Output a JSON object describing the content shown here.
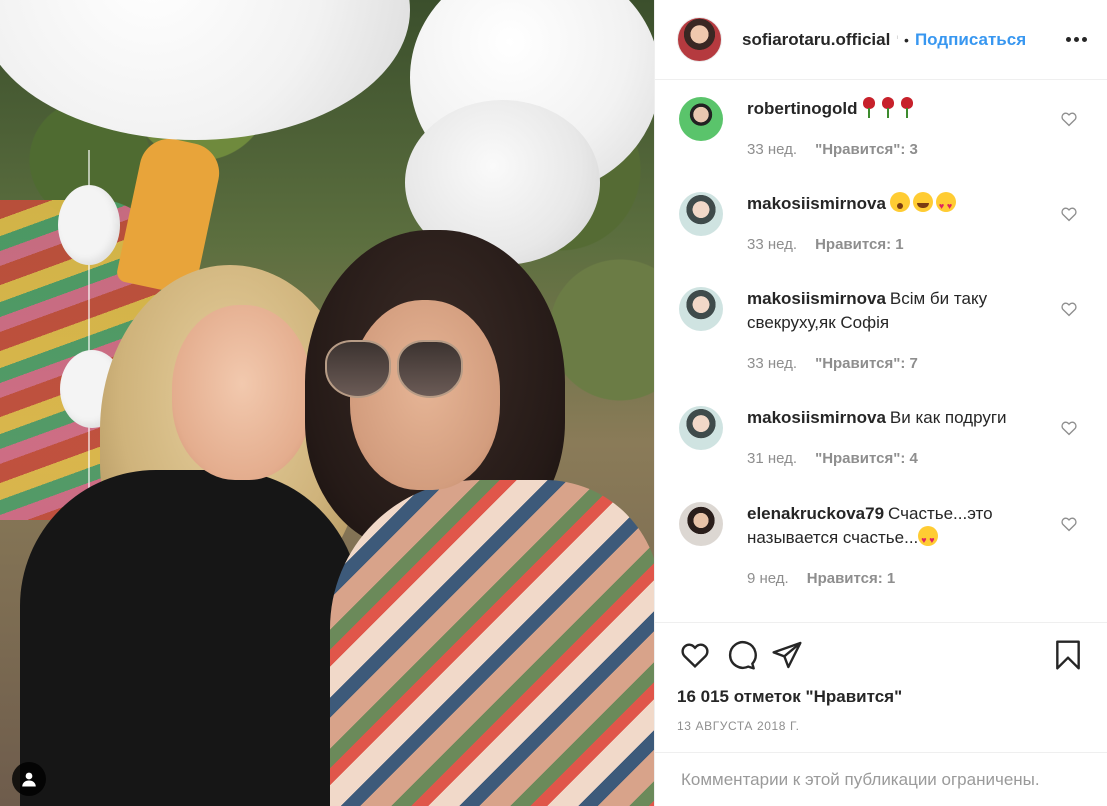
{
  "header": {
    "username": "sofiarotaru.official",
    "verified_mark": "ᑊ",
    "separator": "•",
    "follow_label": "Подписаться"
  },
  "comments": [
    {
      "username": "robertinogold",
      "text": "",
      "emojis": [
        "rose",
        "rose",
        "rose"
      ],
      "text_after": "",
      "time": "33 нед.",
      "likes": "\"Нравится\": 3",
      "avatar": "robertino"
    },
    {
      "username": "makosiismirnova",
      "text": "",
      "emojis": [
        "wow",
        "laugh",
        "hearts"
      ],
      "text_after": "",
      "time": "33 нед.",
      "likes": "Нравится: 1",
      "avatar": "makosi"
    },
    {
      "username": "makosiismirnova",
      "text": "Всім би таку свекруху,як Софія",
      "emojis": [],
      "text_after": "",
      "time": "33 нед.",
      "likes": "\"Нравится\": 7",
      "avatar": "makosi"
    },
    {
      "username": "makosiismirnova",
      "text": "Ви как подруги",
      "emojis": [],
      "text_after": "",
      "time": "31 нед.",
      "likes": "\"Нравится\": 4",
      "avatar": "makosi"
    },
    {
      "username": "elenakruckova79",
      "text": "Счастье...это называется счастье...",
      "emojis": [
        "hearts"
      ],
      "text_after": "",
      "time": "9 нед.",
      "likes": "Нравится: 1",
      "avatar": "elena"
    }
  ],
  "likes_count": "16 015 отметок \"Нравится\"",
  "post_date": "13 августа 2018 г.",
  "comments_restricted": "Комментарии к этой публикации ограничены.",
  "icons": {
    "like": "heart-icon",
    "comment": "comment-icon",
    "share": "share-icon",
    "save": "bookmark-icon",
    "more": "more-options-icon",
    "user_tag": "user-tag-icon"
  },
  "colors": {
    "accent": "#3897f0",
    "text": "#262626",
    "secondary": "#8e8e8e",
    "border": "#efefef"
  }
}
